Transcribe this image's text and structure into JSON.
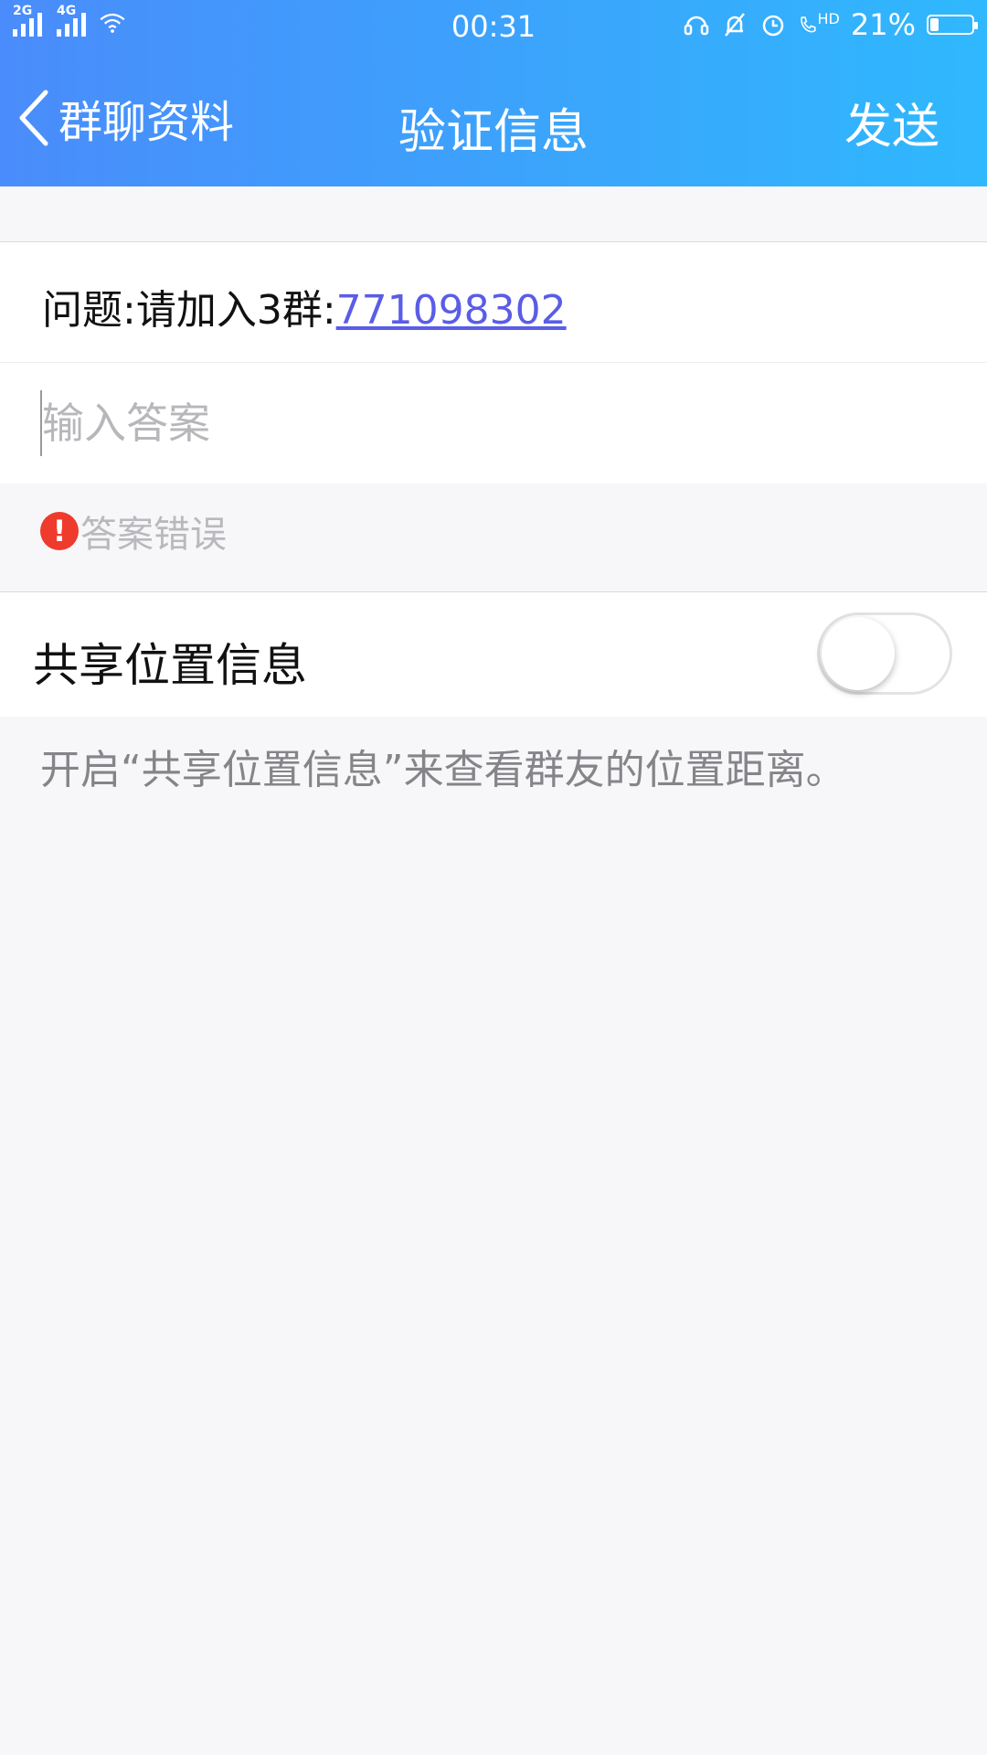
{
  "status_bar": {
    "signal1_label": "2G",
    "signal2_label": "4G",
    "time": "00:31",
    "hd_label": "HD",
    "battery_percent": "21%",
    "battery_level": 0.21
  },
  "nav": {
    "back_label": "群聊资料",
    "title": "验证信息",
    "send_label": "发送"
  },
  "question": {
    "prefix": "问题:请加入3群:",
    "link": "771098302"
  },
  "answer": {
    "placeholder": "输入答案",
    "value": ""
  },
  "error": {
    "icon": "!",
    "message": "答案错误"
  },
  "share_location": {
    "label": "共享位置信息",
    "enabled": false,
    "hint": "开启“共享位置信息”来查看群友的位置距离。"
  },
  "colors": {
    "header_start": "#4a8cfb",
    "header_end": "#2fb8fd",
    "link": "#5a5de6",
    "error": "#ee3b2e"
  }
}
